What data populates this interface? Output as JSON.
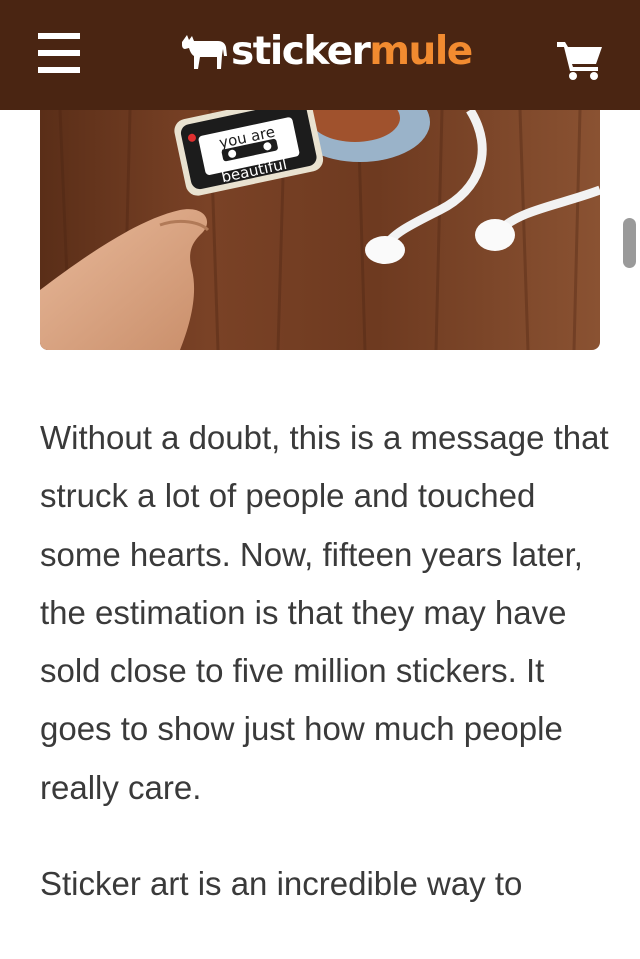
{
  "header": {
    "brand_part1": "sticker",
    "brand_part2": "mule",
    "menu_icon": "hamburger-menu-icon",
    "cart_icon": "shopping-cart-icon"
  },
  "hero": {
    "sticker_text_line1": "you are",
    "sticker_text_line2": "beautiful"
  },
  "article": {
    "paragraph1": "Without a doubt, this is a message that struck a lot of people and touched some hearts. Now, fifteen years later, the estimation is that they may have sold close to five million stickers. It goes to show just how much people really care.",
    "paragraph2": "Sticker art is an incredible way to"
  },
  "colors": {
    "header_bg": "#4a2512",
    "brand_orange": "#f28b30",
    "body_text": "#3a3a3a"
  }
}
